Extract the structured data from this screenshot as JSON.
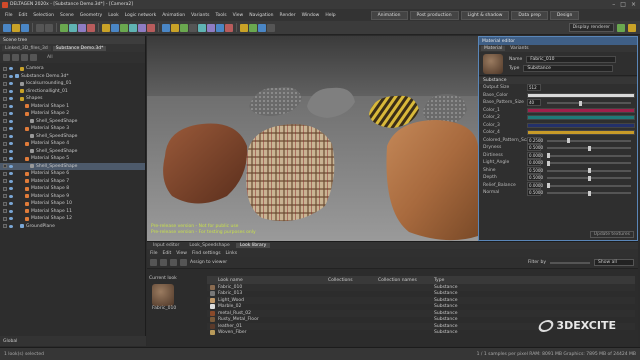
{
  "window": {
    "title": "DELTAGEN 2020x - [Substance Demo.3d*] - [Camera2]"
  },
  "menu": [
    "File",
    "Edit",
    "Selection",
    "Scene",
    "Geometry",
    "Look",
    "Logic network",
    "Animation",
    "Variants",
    "Tools",
    "View",
    "Navigation",
    "Render",
    "Window",
    "Help"
  ],
  "workspace_tabs": [
    "Animation",
    "Post production",
    "Light & shadow",
    "Data prep",
    "Design"
  ],
  "toolbar": {
    "display_label": "Display renderer"
  },
  "left_panel": {
    "title": "Scene tree",
    "tabs": [
      "Linked_3D_files_3d",
      "Substance Demo.3d*"
    ],
    "filter_label": "All",
    "tree": [
      {
        "label": "Camera",
        "color": "#c9a227",
        "indent": 1
      },
      {
        "label": "Substance Demo.3d*",
        "color": "#7aa7d6",
        "indent": 0,
        "selected": false
      },
      {
        "label": "localsurrounding_01",
        "color": "#999",
        "indent": 1
      },
      {
        "label": "directionallight_01",
        "color": "#c9a227",
        "indent": 1
      },
      {
        "label": "Shapes",
        "color": "#c9a227",
        "indent": 1
      },
      {
        "label": "Material Shape 1",
        "color": "#e07b39",
        "indent": 2
      },
      {
        "label": "Material Shape 2",
        "color": "#e07b39",
        "indent": 2
      },
      {
        "label": "Shell_SpeedShape",
        "color": "#999",
        "indent": 3
      },
      {
        "label": "Material Shape 3",
        "color": "#e07b39",
        "indent": 2
      },
      {
        "label": "Shell_SpeedShape",
        "color": "#999",
        "indent": 3
      },
      {
        "label": "Material Shape 4",
        "color": "#e07b39",
        "indent": 2
      },
      {
        "label": "Shell_SpeedShape",
        "color": "#999",
        "indent": 3
      },
      {
        "label": "Material Shape 5",
        "color": "#e07b39",
        "indent": 2
      },
      {
        "label": "Shell_SpeedShape",
        "color": "#999",
        "indent": 3,
        "selected": true
      },
      {
        "label": "Material Shape 6",
        "color": "#e07b39",
        "indent": 2
      },
      {
        "label": "Material Shape 7",
        "color": "#e07b39",
        "indent": 2
      },
      {
        "label": "Material Shape 8",
        "color": "#e07b39",
        "indent": 2
      },
      {
        "label": "Material Shape 9",
        "color": "#e07b39",
        "indent": 2
      },
      {
        "label": "Material Shape 10",
        "color": "#e07b39",
        "indent": 2
      },
      {
        "label": "Material Shape 11",
        "color": "#e07b39",
        "indent": 2
      },
      {
        "label": "Material Shape 12",
        "color": "#e07b39",
        "indent": 2
      },
      {
        "label": "GroundPlane",
        "color": "#7aa7d6",
        "indent": 1
      }
    ],
    "footer": "Global"
  },
  "viewport": {
    "overlay_line1": "Pre-release version - Not for public use",
    "overlay_line2": "Pre-release version - For testing purposes only"
  },
  "material_editor": {
    "title": "Material editor",
    "tabs": [
      "Material",
      "Variants"
    ],
    "name_label": "Name",
    "name_value": "Fabric_010",
    "type_label": "Type",
    "type_value": "Substance",
    "section": "Substance",
    "output_size_label": "Output Size",
    "output_size_value": "512",
    "properties": [
      {
        "label": "Base_Color",
        "kind": "swatch",
        "color": "#d9d9d9"
      },
      {
        "label": "Base_Pattern_Size",
        "value": "40",
        "pos": 0.4
      },
      {
        "label": "Color_1",
        "kind": "swatch",
        "color": "#a0204a"
      },
      {
        "label": "Color_2",
        "kind": "swatch",
        "color": "#1f7a78"
      },
      {
        "label": "Color_3",
        "kind": "swatch",
        "color": "#23306a"
      },
      {
        "label": "Color_4",
        "kind": "swatch",
        "color": "#c79a28"
      },
      {
        "label": "Colored_Pattern_Scale",
        "value": "0.2500",
        "pos": 0.25
      },
      {
        "label": "Dryness",
        "value": "0.5000",
        "pos": 0.5
      },
      {
        "label": "Dirtiness",
        "value": "0.0000",
        "pos": 0.0
      },
      {
        "label": "Light_Angle",
        "value": "0.0000",
        "pos": 0.0
      },
      {
        "label": "Shine",
        "value": "0.5000",
        "pos": 0.5
      },
      {
        "label": "Depth",
        "value": "0.5000",
        "pos": 0.5
      },
      {
        "label": "Relief_Balance",
        "value": "0.0000",
        "pos": 0.0
      },
      {
        "label": "Normal",
        "value": "0.5000",
        "pos": 0.5
      }
    ],
    "footer_button": "Update textures"
  },
  "bottom_panel": {
    "tabs": [
      "Input editor",
      "Look_Speedshape",
      "Look library"
    ],
    "menu": [
      "File",
      "Edit",
      "View",
      "Find settings",
      "Links"
    ],
    "assign_label": "Assign to viewer",
    "filter_label": "Filter by",
    "show_label": "Show all",
    "current_look_label": "Current look",
    "current_look_name": "Fabric_010",
    "columns": [
      "Look name",
      "Collections",
      "Collection names",
      "Type"
    ],
    "rows": [
      {
        "name": "Fabric_010",
        "type": "Substance",
        "color": "#8a6b50"
      },
      {
        "name": "Fabric_013",
        "type": "Substance",
        "color": "#777"
      },
      {
        "name": "Light_Wood",
        "type": "Substance",
        "color": "#c29a6a"
      },
      {
        "name": "Marble_02",
        "type": "Substance",
        "color": "#ddd"
      },
      {
        "name": "metal_Rust_02",
        "type": "Substance",
        "color": "#8a4a2a"
      },
      {
        "name": "Rusty_Metal_Floor",
        "type": "Substance",
        "color": "#7a5a3a"
      },
      {
        "name": "leather_01",
        "type": "Substance",
        "color": "#5a3a2a"
      },
      {
        "name": "Woven_Fiber",
        "type": "Substance",
        "color": "#b89a5a"
      }
    ],
    "brand": "3DEXCITE"
  },
  "statusbar": {
    "left": "1 look(s) selected",
    "right": "1 / 1 samples per pixel   RAM: 8091 MB   Graphics: 7895 MB of 24424 MB"
  }
}
